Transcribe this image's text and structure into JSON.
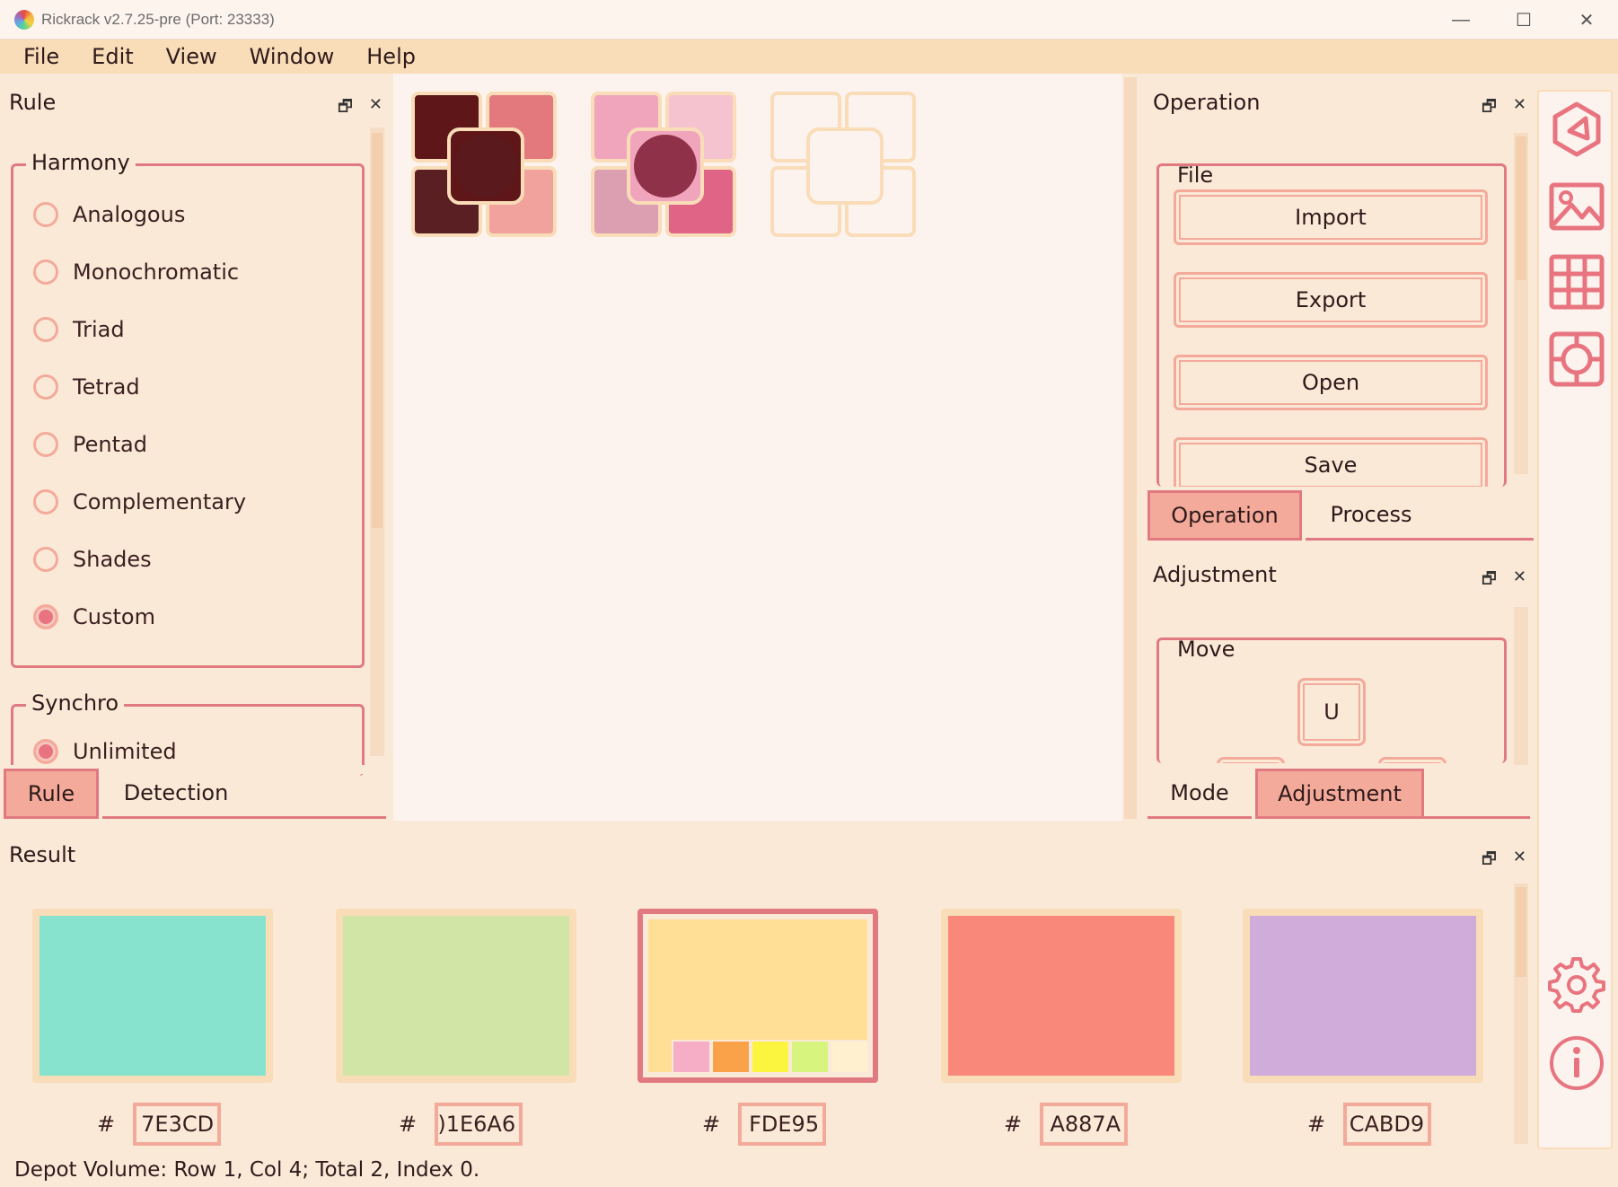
{
  "window": {
    "title": "Rickrack v2.7.25-pre (Port: 23333)",
    "controls": [
      "—",
      "☐",
      "✕"
    ]
  },
  "menu": [
    "File",
    "Edit",
    "View",
    "Window",
    "Help"
  ],
  "rule_panel": {
    "title": "Rule",
    "harmony": {
      "label": "Harmony",
      "options": [
        "Analogous",
        "Monochromatic",
        "Triad",
        "Tetrad",
        "Pentad",
        "Complementary",
        "Shades",
        "Custom"
      ],
      "selected": "Custom"
    },
    "synchro": {
      "label": "Synchro",
      "options": [
        "Unlimited"
      ],
      "selected": "Unlimited"
    },
    "tabs": [
      "Rule",
      "Detection"
    ],
    "active_tab": "Rule"
  },
  "depot": {
    "palettes": [
      {
        "colors": [
          "#5e1619",
          "#e3797c",
          "#5a1f22",
          "#f1a29c"
        ],
        "center": "#5a1a1d"
      },
      {
        "colors": [
          "#f0a5bc",
          "#f5c3cf",
          "#dc9fb2",
          "#e06486"
        ],
        "center": "#8e3149"
      },
      {
        "colors": [],
        "center": ""
      }
    ]
  },
  "operation_panel": {
    "title": "Operation",
    "file_group": {
      "label": "File",
      "buttons": [
        "Import",
        "Export",
        "Open",
        "Save"
      ]
    },
    "tabs": [
      "Operation",
      "Process"
    ],
    "active_tab": "Operation"
  },
  "adjustment_panel": {
    "title": "Adjustment",
    "move_group": {
      "label": "Move",
      "up_label": "U"
    },
    "tabs": [
      "Mode",
      "Adjustment"
    ],
    "active_tab": "Adjustment"
  },
  "sidebar_icons": [
    "wheel-icon",
    "image-icon",
    "grid-icon",
    "depot-icon",
    "settings-icon",
    "info-icon"
  ],
  "result_panel": {
    "title": "Result",
    "swatches": [
      {
        "color": "#87e3cd",
        "hex": "7E3CD",
        "selected": false
      },
      {
        "color": "#d1e6a6",
        "hex": ")1E6A6",
        "selected": false
      },
      {
        "color": "#ffde95",
        "hex": "FDE95",
        "selected": true
      },
      {
        "color": "#fa887a",
        "hex": "A887A",
        "selected": false
      },
      {
        "color": "#cfacda",
        "hex": "CABD9",
        "selected": false
      }
    ],
    "mini_colors": [
      "#f6aec6",
      "#f9a24a",
      "#fbf540",
      "#d7f47e",
      "#fff0cf"
    ],
    "hash": "#"
  },
  "status": "Depot Volume: Row 1, Col 4; Total 2, Index 0.",
  "dock": {
    "float": "🗗",
    "close": "✕"
  }
}
